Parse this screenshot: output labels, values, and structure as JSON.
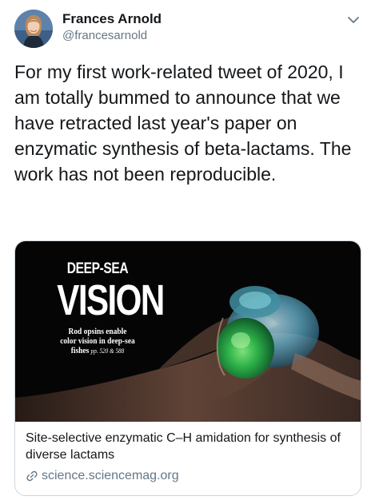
{
  "author": {
    "display_name": "Frances Arnold",
    "handle": "@francesarnold",
    "avatar_icon": "profile-photo"
  },
  "tweet": {
    "text": "For my first work-related tweet of 2020, I am totally bummed to announce that we have retracted last year's paper on enzymatic synthesis of beta-lactams. The work has not been reproducible."
  },
  "card": {
    "image": {
      "kicker": "DEEP-SEA",
      "title": "VISION",
      "subtitle_line1": "Rod opsins enable",
      "subtitle_line2": "color vision in deep-sea",
      "subtitle_line3": "fishes",
      "pages": "pp. 520 & 588"
    },
    "title": "Site-selective enzymatic C–H amidation for synthesis of diverse lactams",
    "domain": "science.sciencemag.org"
  },
  "colors": {
    "text_primary": "#14171a",
    "text_secondary": "#657786",
    "border": "#ccd6dd"
  }
}
